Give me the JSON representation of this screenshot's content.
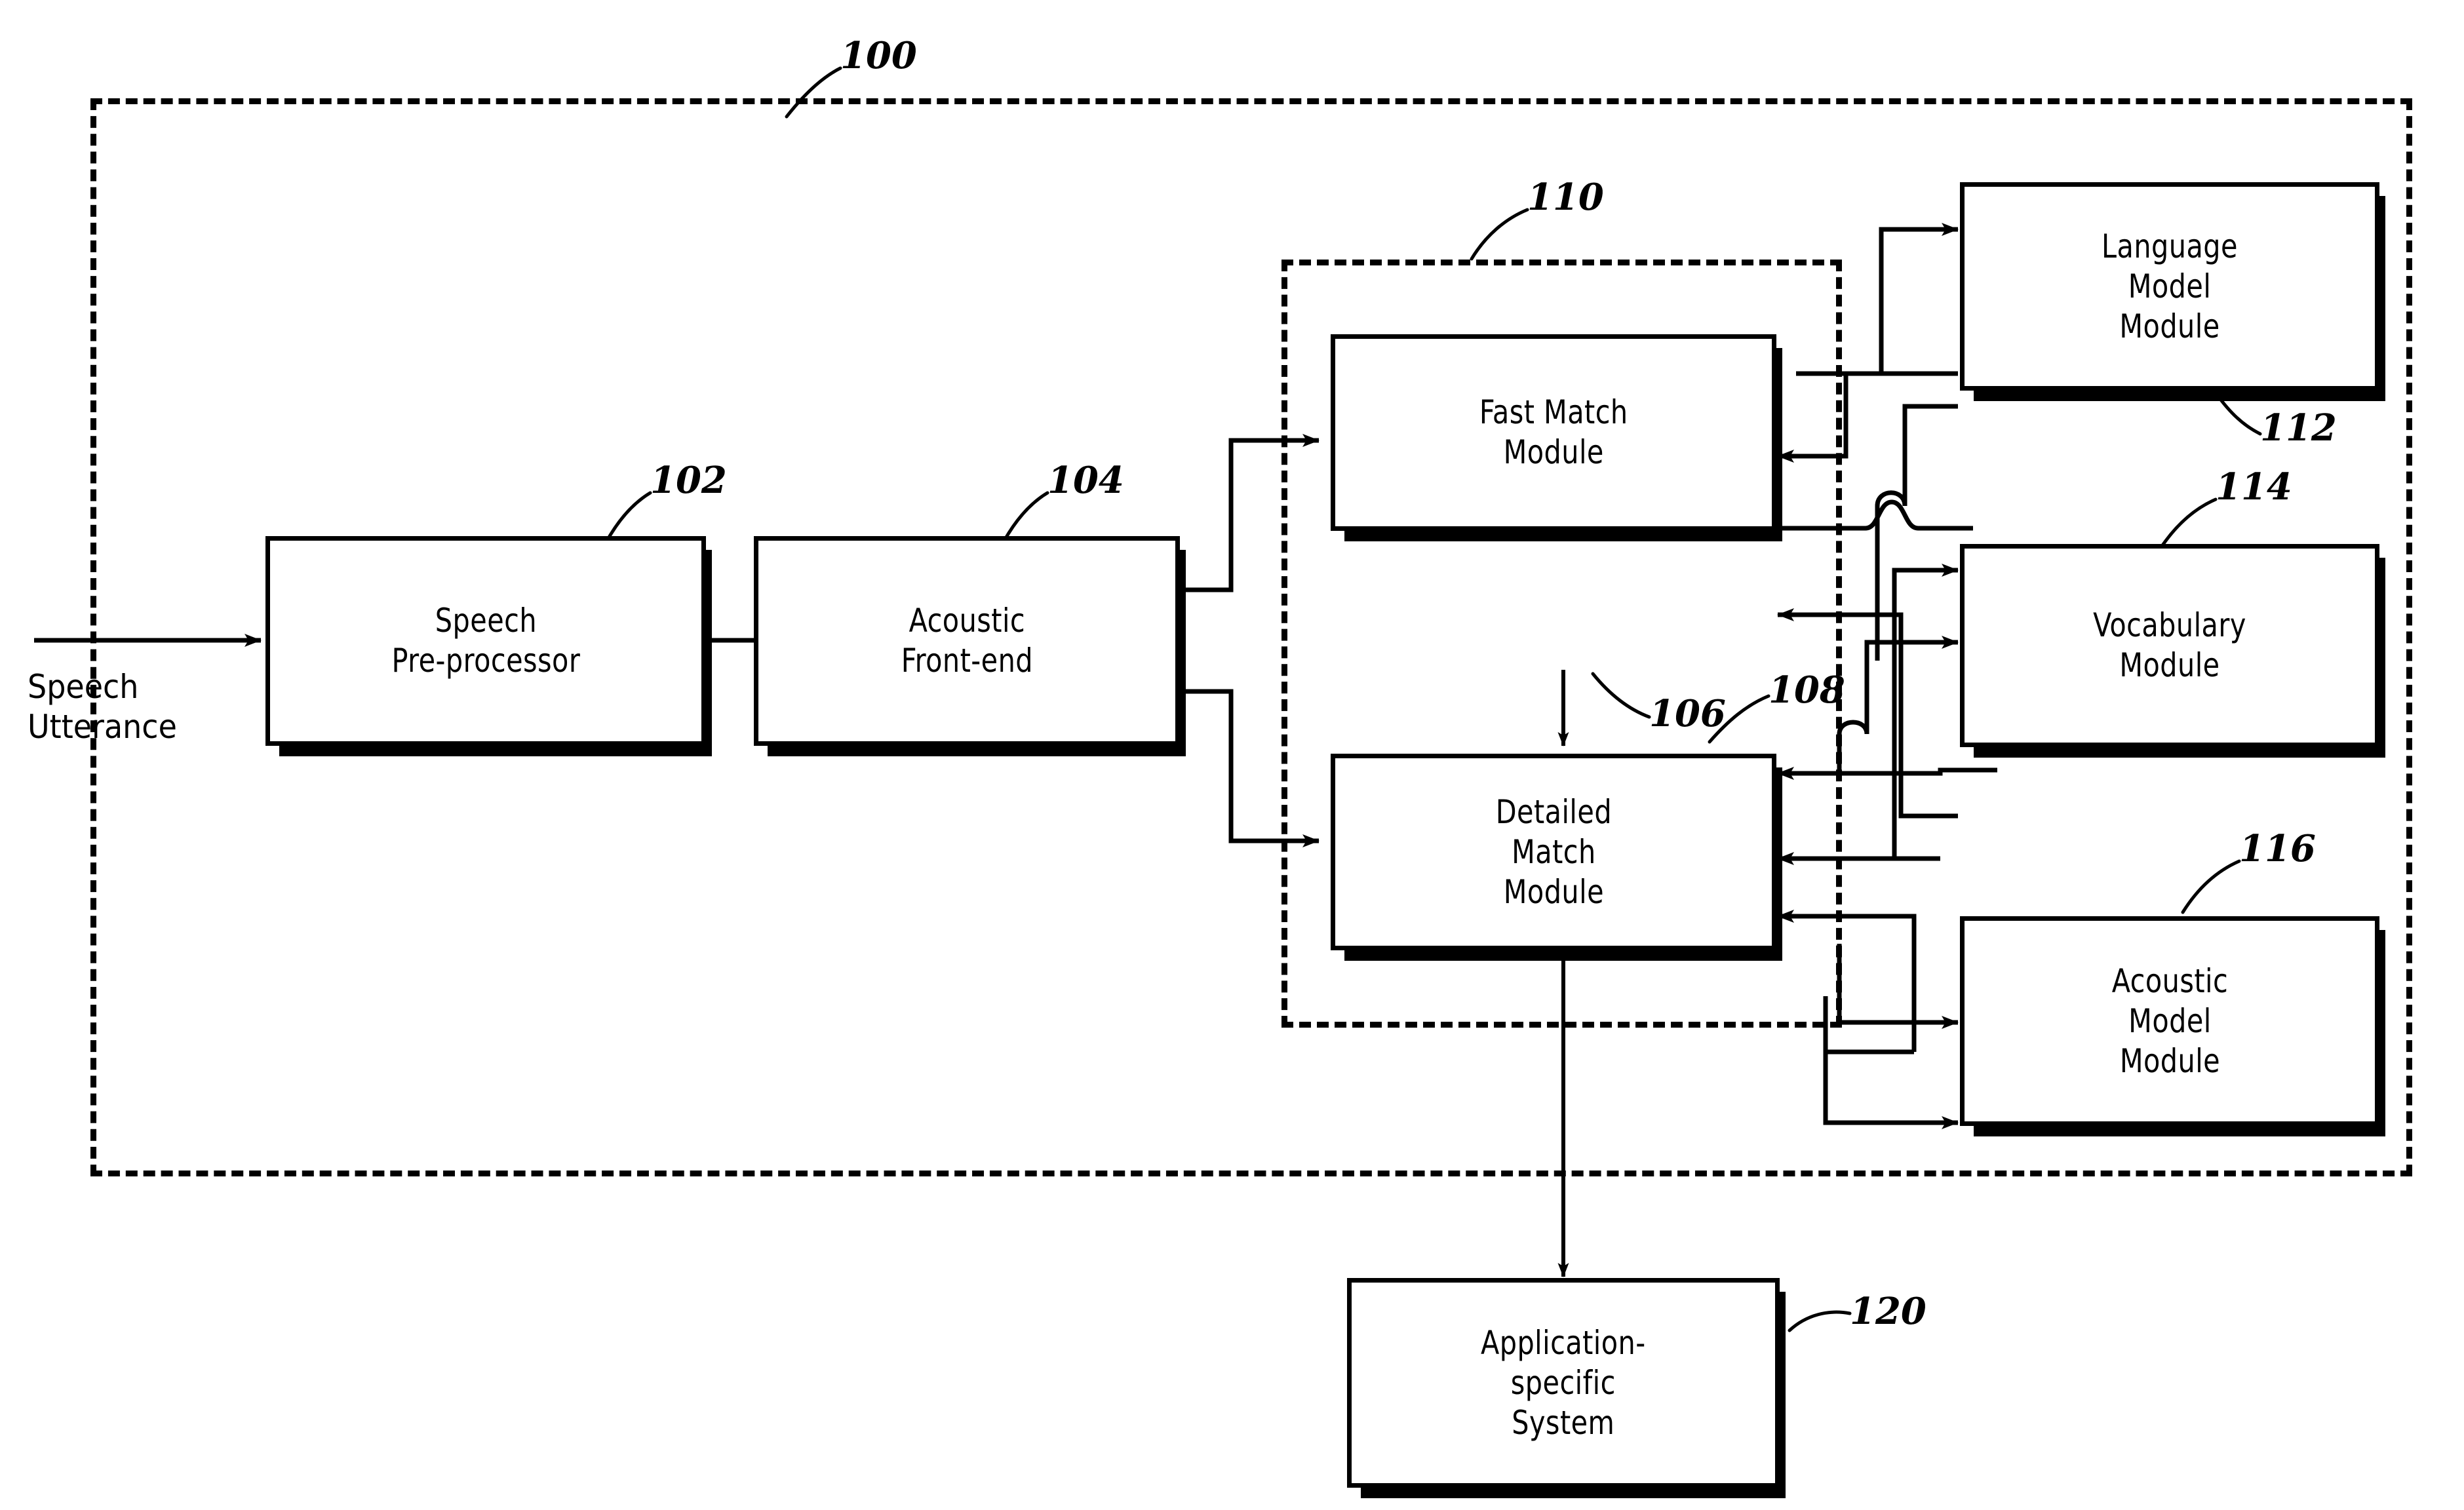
{
  "figure": {
    "type": "patent-block-diagram",
    "title_numeral": "100",
    "description": "Speech recognition system block diagram"
  },
  "input_label": {
    "text": "Speech\nUtterance"
  },
  "enclosures": [
    {
      "id": "system",
      "numeral": "100",
      "name": "speech-recognition-system-boundary"
    },
    {
      "id": "search",
      "numeral": "110",
      "name": "search-engine-boundary"
    }
  ],
  "blocks": [
    {
      "id": "speech_preprocessor",
      "label": "Speech\nPre-processor",
      "numeral": "102"
    },
    {
      "id": "acoustic_frontend",
      "label": "Acoustic\nFront-end",
      "numeral": "104"
    },
    {
      "id": "fast_match",
      "label": "Fast  Match\nModule",
      "numeral": "106"
    },
    {
      "id": "detailed_match",
      "label": "Detailed\nMatch\nModule",
      "numeral": "108"
    },
    {
      "id": "language_model",
      "label": "Language\nModel\nModule",
      "numeral": "112"
    },
    {
      "id": "vocabulary",
      "label": "Vocabulary\nModule",
      "numeral": "114"
    },
    {
      "id": "acoustic_model",
      "label": "Acoustic\nModel\nModule",
      "numeral": "116"
    },
    {
      "id": "application_system",
      "label": "Application-\nspecific\nSystem",
      "numeral": "120"
    }
  ],
  "colors": {
    "stroke": "#000000",
    "background": "#ffffff"
  }
}
